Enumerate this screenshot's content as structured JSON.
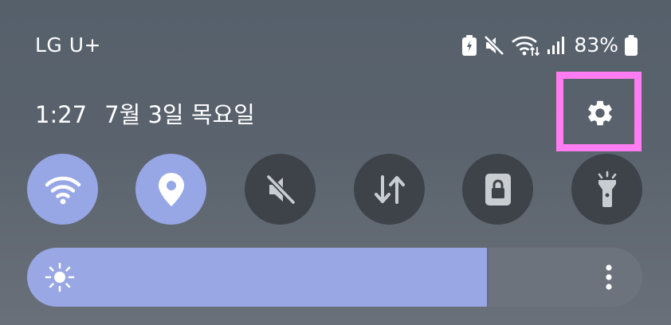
{
  "status_bar": {
    "carrier": "LG U+",
    "battery_percent": "83%",
    "icons": [
      "battery-saver-icon",
      "mute-icon",
      "wifi-icon",
      "signal-icon",
      "battery-icon"
    ]
  },
  "header": {
    "time": "1:27",
    "date": "7월 3일 목요일",
    "settings_icon": "gear-icon"
  },
  "quick_toggles": [
    {
      "name": "wifi",
      "icon": "wifi-icon",
      "state": "on"
    },
    {
      "name": "location",
      "icon": "location-pin-icon",
      "state": "on"
    },
    {
      "name": "sound",
      "icon": "mute-icon",
      "state": "off"
    },
    {
      "name": "mobile-data",
      "icon": "data-transfer-icon",
      "state": "off"
    },
    {
      "name": "rotation-lock",
      "icon": "lock-icon",
      "state": "off"
    },
    {
      "name": "flashlight",
      "icon": "flashlight-icon",
      "state": "off"
    }
  ],
  "brightness": {
    "level_fraction": 0.75,
    "icon": "sun-icon",
    "more_icon": "more-vertical-icon"
  },
  "colors": {
    "toggle_on": "#97a7e6",
    "toggle_off": "#3e434a",
    "highlight": "#ff7cf2"
  }
}
